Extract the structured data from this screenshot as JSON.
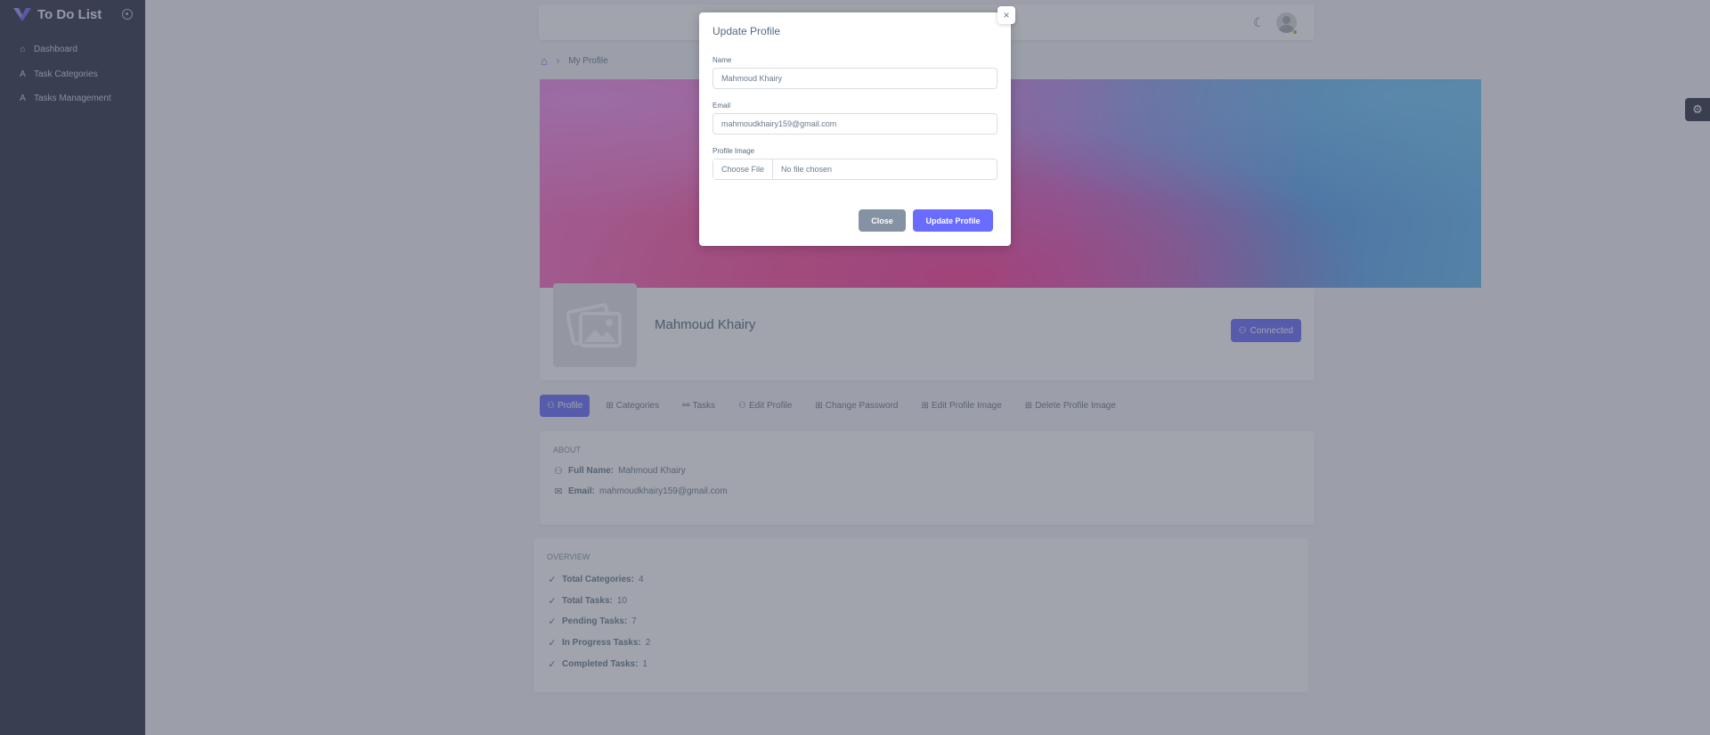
{
  "sidebar": {
    "app_title": "To Do List",
    "items": [
      {
        "label": "Dashboard",
        "icon": "home-icon"
      },
      {
        "label": "Task Categories",
        "icon": "text-icon"
      },
      {
        "label": "Tasks Management",
        "icon": "text-icon"
      }
    ]
  },
  "breadcrumb": {
    "current": "My Profile"
  },
  "profile": {
    "name": "Mahmoud Khairy",
    "connected_label": "Connected"
  },
  "tabs": [
    {
      "label": "Profile",
      "active": true
    },
    {
      "label": "Categories"
    },
    {
      "label": "Tasks"
    },
    {
      "label": "Edit Profile"
    },
    {
      "label": "Change Password"
    },
    {
      "label": "Edit Profile Image"
    },
    {
      "label": "Delete Profile Image"
    }
  ],
  "about": {
    "title": "ABOUT",
    "rows": [
      {
        "label": "Full Name:",
        "value": "Mahmoud Khairy"
      },
      {
        "label": "Email:",
        "value": "mahmoudkhairy159@gmail.com"
      }
    ]
  },
  "overview": {
    "title": "OVERVIEW",
    "rows": [
      {
        "label": "Total Categories:",
        "value": "4"
      },
      {
        "label": "Total Tasks:",
        "value": "10"
      },
      {
        "label": "Pending Tasks:",
        "value": "7"
      },
      {
        "label": "In Progress Tasks:",
        "value": "2"
      },
      {
        "label": "Completed Tasks:",
        "value": "1"
      }
    ]
  },
  "modal": {
    "title": "Update Profile",
    "name_label": "Name",
    "name_value": "Mahmoud Khairy",
    "email_label": "Email",
    "email_value": "mahmoudkhairy159@gmail.com",
    "image_label": "Profile Image",
    "choose_file_label": "Choose File",
    "no_file_label": "No file chosen",
    "close_label": "Close",
    "update_label": "Update Profile",
    "close_x": "×"
  },
  "colors": {
    "primary": "#696cff",
    "sidebar_bg": "#2f3349",
    "secondary": "#8592a3"
  }
}
